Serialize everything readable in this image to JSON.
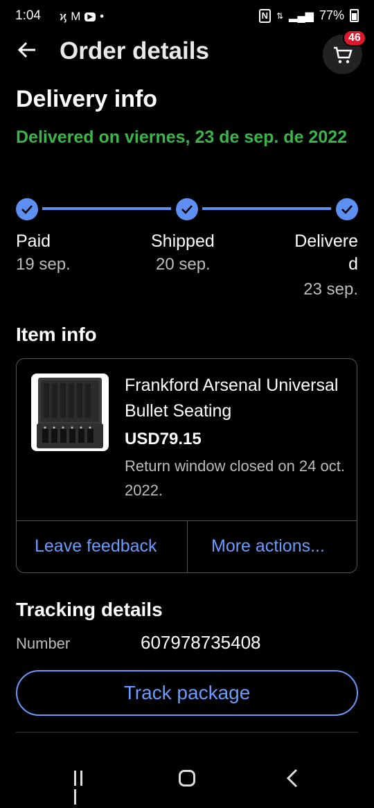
{
  "status_bar": {
    "time": "1:04",
    "battery": "77%"
  },
  "header": {
    "title": "Order details",
    "cart_count": "46"
  },
  "delivery": {
    "heading": "Delivery info",
    "status_text": "Delivered on viernes, 23 de sep. de 2022",
    "steps": [
      {
        "label": "Paid",
        "date": "19 sep."
      },
      {
        "label": "Shipped",
        "date": "20 sep."
      },
      {
        "label_line1": "Delivere",
        "label_line2": "d",
        "date": "23 sep."
      }
    ],
    "accent_color": "#5e8ff2",
    "status_color": "#3bb54a"
  },
  "item": {
    "heading": "Item info",
    "title": "Frankford Arsenal Universal Bullet Seating",
    "price": "USD79.15",
    "return_text": "Return window closed on 24 oct. 2022.",
    "leave_feedback": "Leave feedback",
    "more_actions": "More actions..."
  },
  "tracking": {
    "heading": "Tracking details",
    "number_label": "Number",
    "number": "607978735408",
    "track_button": "Track package"
  }
}
